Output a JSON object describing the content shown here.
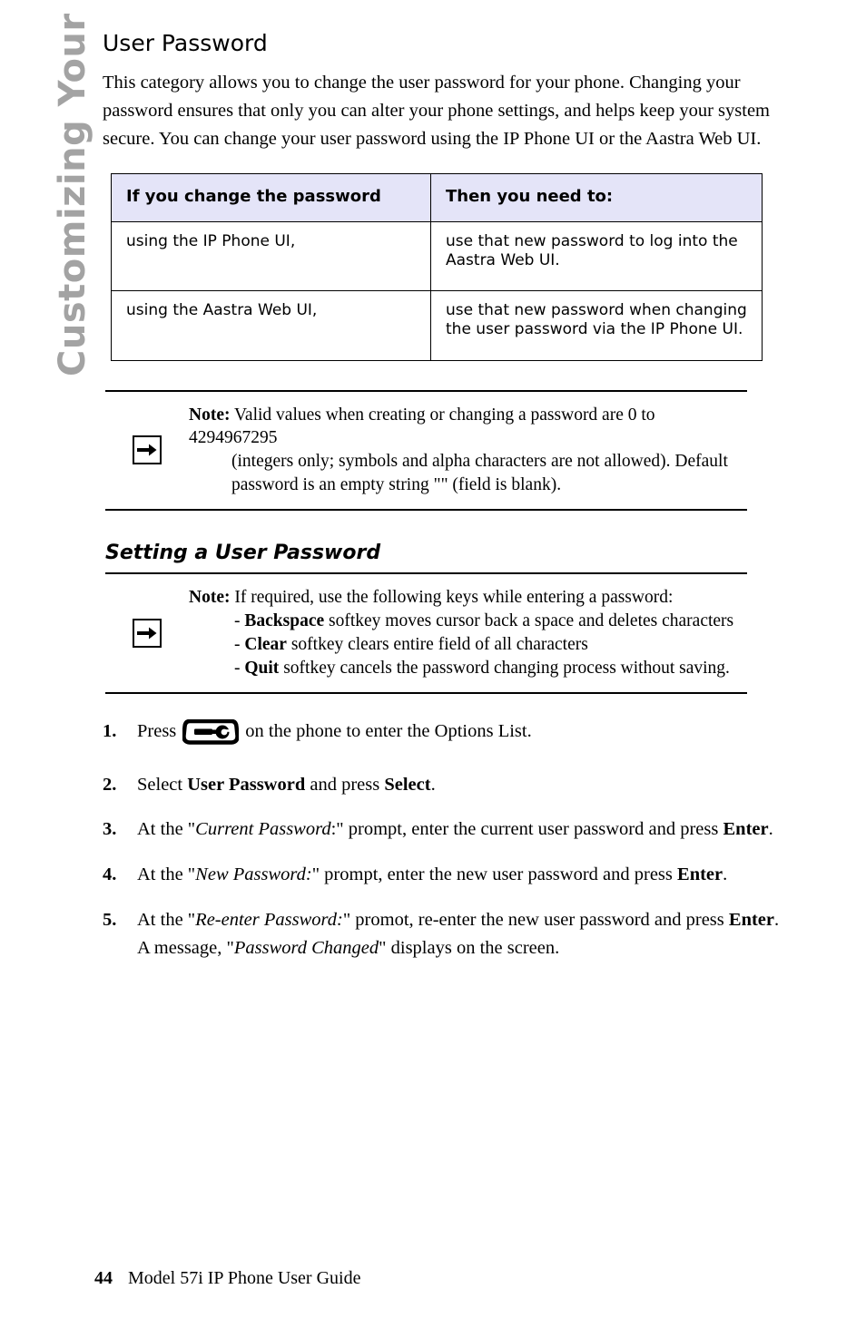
{
  "sidebar": {
    "chapter_label": "Customizing Your Phone",
    "color": "#a3a3a3"
  },
  "page": {
    "heading": "User Password",
    "intro": "This category allows you to change the user password for your phone. Changing your password ensures that only you can alter your phone settings, and helps keep your system secure. You can change your user password using the IP Phone UI or the Aastra Web UI."
  },
  "table": {
    "header_bg": "#e4e4f8",
    "headers": [
      "If you change the password",
      "Then you need to:"
    ],
    "rows": [
      [
        "using the IP Phone UI,",
        "use that new password to log into the Aastra Web UI."
      ],
      [
        "using the Aastra Web UI,",
        "use that new password when changing the user password via the IP Phone UI."
      ]
    ]
  },
  "note1": {
    "icon": "arrow-right-icon",
    "label": "Note:",
    "line1": "Valid values when creating or changing a password are 0 to 4294967295",
    "line2": "(integers only; symbols and alpha characters are not allowed). Default",
    "line3": "password is an empty string \"\" (field is blank)."
  },
  "subheading": "Setting a User Password",
  "note2": {
    "icon": "arrow-right-icon",
    "label": "Note:",
    "intro": "If required, use the following keys while entering a password:",
    "bullets": [
      {
        "dash": "- ",
        "key": "Backspace",
        "text": " softkey moves cursor back a space and deletes characters"
      },
      {
        "dash": "- ",
        "key": "Clear",
        "text": " softkey clears entire field of all characters"
      },
      {
        "dash": "- ",
        "key": "Quit",
        "text": " softkey cancels the password changing process without saving."
      }
    ]
  },
  "steps": [
    {
      "num": "1.",
      "pre": "Press",
      "icon": "options-key-icon",
      "post": "on the phone to enter the Options List."
    },
    {
      "num": "2.",
      "p1": "Select ",
      "b1": "User Password",
      "p2": " and press ",
      "b2": "Select",
      "p3": "."
    },
    {
      "num": "3.",
      "p1": "At the \"",
      "i1": "Current Password",
      "p2": ":\" prompt, enter the current user password and press ",
      "b1": "Enter",
      "p3": "."
    },
    {
      "num": "4.",
      "p1": "At the \"",
      "i1": "New Password:",
      "p2": "\" prompt, enter the new user password and press ",
      "b1": "Enter",
      "p3": "."
    },
    {
      "num": "5.",
      "p1": "At the \"",
      "i1": "Re-enter Password:",
      "p2": "\" promot, re-enter the new user password and press ",
      "b1": "Enter",
      "p3": ".",
      "extra_pre": "A message, \"",
      "extra_i": "Password Changed",
      "extra_post": "\" displays on the screen."
    }
  ],
  "footer": {
    "page_number": "44",
    "title": "Model 57i IP Phone User Guide"
  }
}
